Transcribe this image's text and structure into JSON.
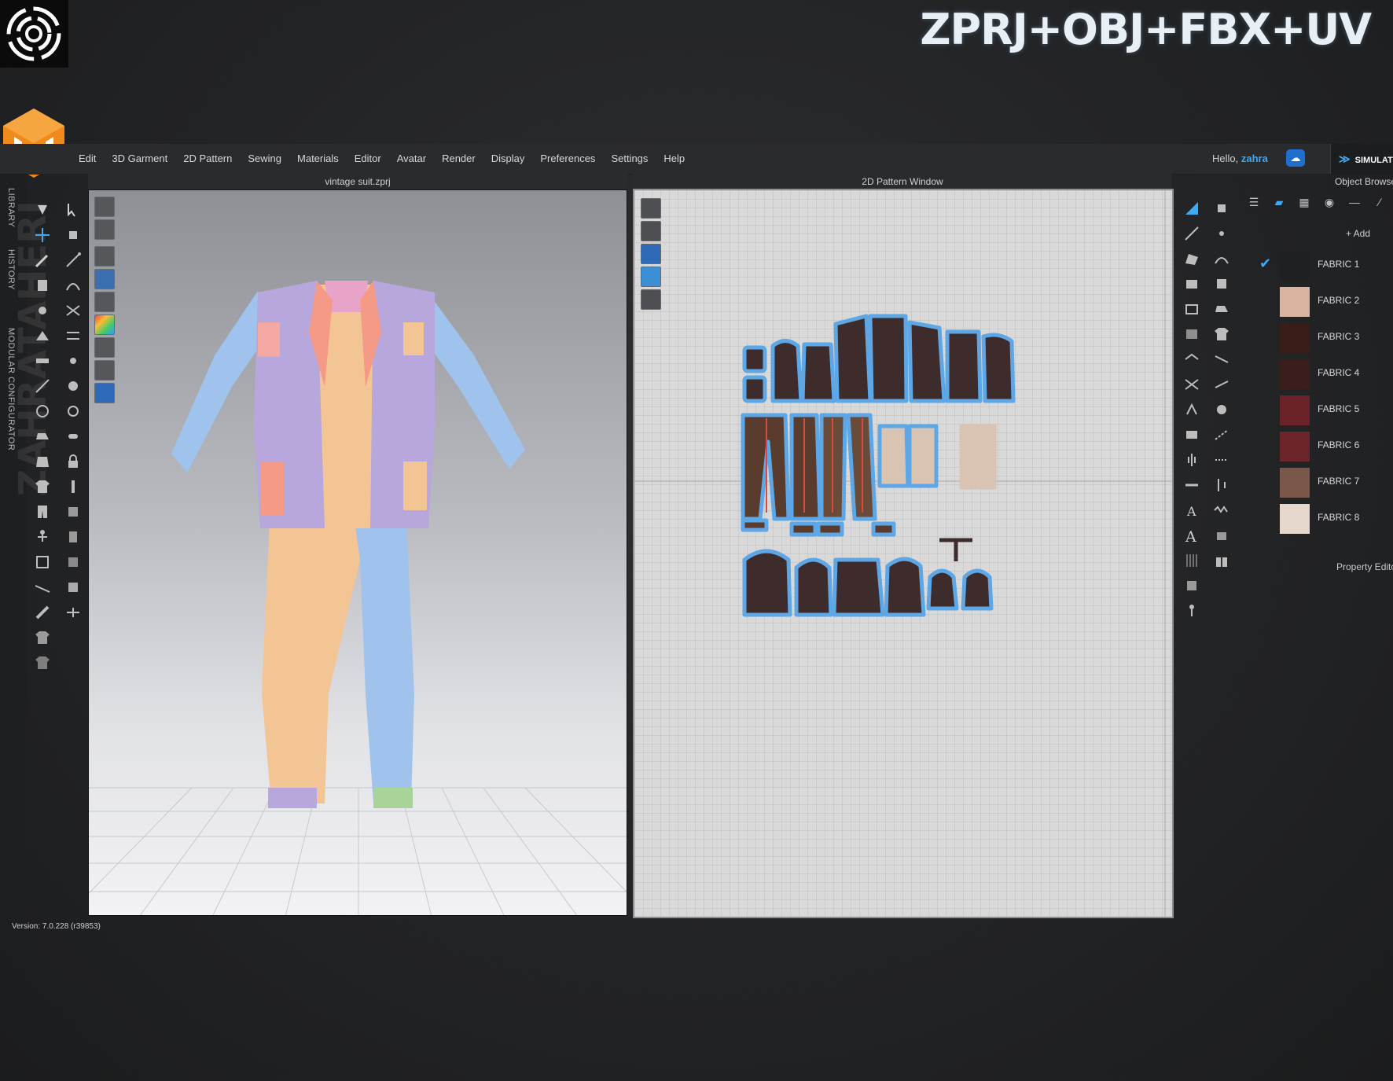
{
  "banner": {
    "headline": "ZPRJ+OBJ+FBX+UV"
  },
  "menu": {
    "items": [
      "Edit",
      "3D Garment",
      "2D Pattern",
      "Sewing",
      "Materials",
      "Editor",
      "Avatar",
      "Render",
      "Display",
      "Preferences",
      "Settings",
      "Help"
    ]
  },
  "account": {
    "greeting": "Hello,",
    "username": "zahra"
  },
  "simulate_label": "SIMULATE",
  "side_tabs": {
    "library": "LIBRARY",
    "history": "HISTORY",
    "modular": "MODULAR CONFIGURATOR"
  },
  "watermark": "ZAHRATAHERI",
  "viewport3d": {
    "title": "vintage suit.zprj"
  },
  "pattern_window": {
    "title": "2D Pattern Window"
  },
  "object_browser": {
    "title": "Object Browser",
    "add_label": "+ Add",
    "fabrics": [
      {
        "name": "FABRIC 1",
        "color": "#1f2023",
        "checked": true
      },
      {
        "name": "FABRIC 2",
        "color": "#d9b4a0"
      },
      {
        "name": "FABRIC 3",
        "color": "#3a1c18"
      },
      {
        "name": "FABRIC 4",
        "color": "#3b1e1b"
      },
      {
        "name": "FABRIC 5",
        "color": "#6b2327"
      },
      {
        "name": "FABRIC 6",
        "color": "#6e2529"
      },
      {
        "name": "FABRIC 7",
        "color": "#7a5748"
      },
      {
        "name": "FABRIC 8",
        "color": "#e6d8cc"
      }
    ]
  },
  "property_editor": {
    "title": "Property Editor"
  },
  "version": "Version: 7.0.228 (r39853)",
  "colors": {
    "accent": "#3fa9f5",
    "menubar": "#2a2b2d",
    "pattern_bg": "#d9d9d9",
    "garment_pattern": "#3d2c2b",
    "pattern_outline": "#5ea7e6"
  }
}
